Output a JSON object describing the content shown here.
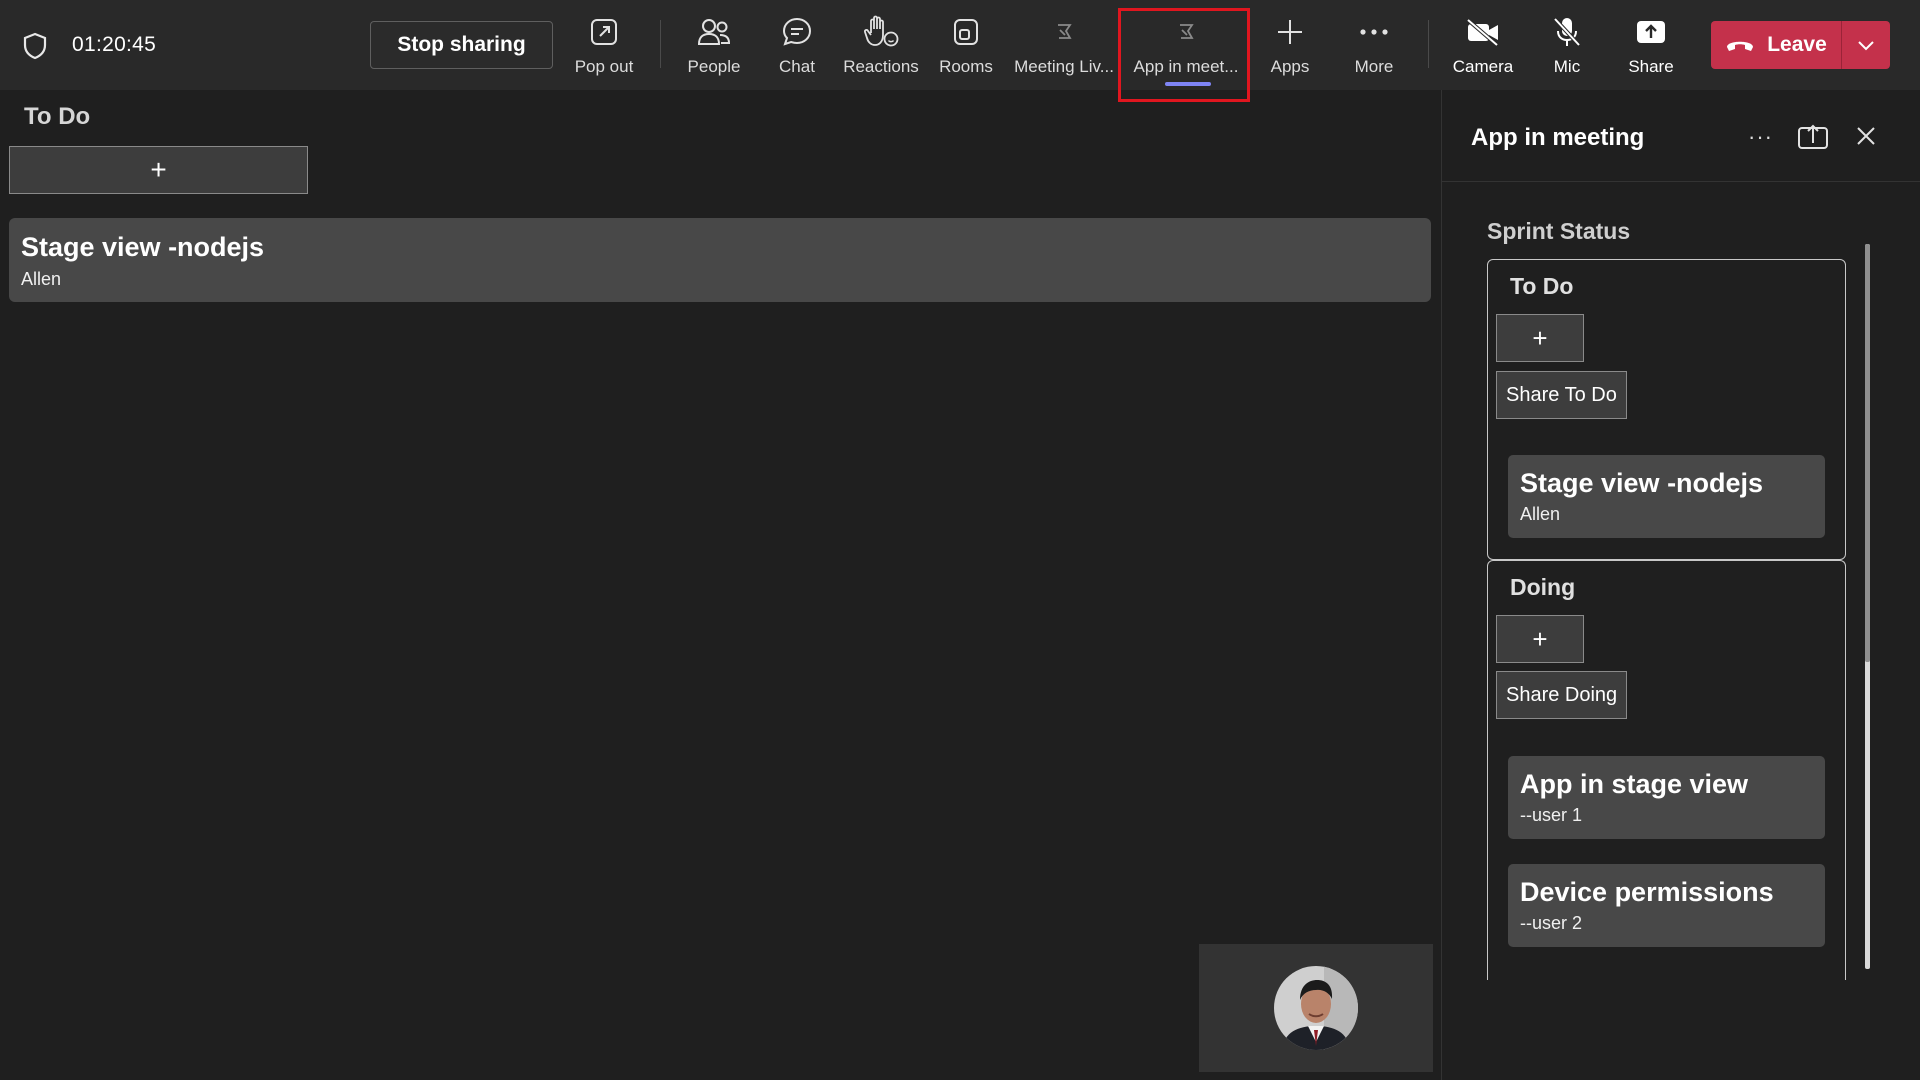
{
  "meeting": {
    "timer": "01:20:45",
    "stop_sharing_label": "Stop sharing"
  },
  "toolbar": {
    "items": [
      {
        "label": "Pop out",
        "icon": "pop-out-icon"
      },
      {
        "label": "People",
        "icon": "people-icon"
      },
      {
        "label": "Chat",
        "icon": "chat-icon"
      },
      {
        "label": "Reactions",
        "icon": "raise-hand-icon"
      },
      {
        "label": "Rooms",
        "icon": "rooms-icon"
      },
      {
        "label": "Meeting Liv...",
        "icon": "app-icon"
      },
      {
        "label": "App in meet...",
        "icon": "app-icon",
        "selected": true
      },
      {
        "label": "Apps",
        "icon": "plus-icon"
      },
      {
        "label": "More",
        "icon": "more-icon"
      },
      {
        "label": "Camera",
        "icon": "camera-off-icon"
      },
      {
        "label": "Mic",
        "icon": "mic-off-icon"
      },
      {
        "label": "Share",
        "icon": "share-icon"
      }
    ],
    "leave_label": "Leave",
    "accent_color": "#c4314b",
    "highlight_color": "#e0161f"
  },
  "stage": {
    "column_title": "To Do",
    "add_label": "+",
    "cards": [
      {
        "title": "Stage view -nodejs",
        "subtitle": "Allen"
      }
    ]
  },
  "panel": {
    "title": "App in meeting",
    "more_label": "···",
    "section_title": "Sprint Status",
    "columns": [
      {
        "title": "To Do",
        "add_label": "+",
        "share_label": "Share To Do",
        "cards": [
          {
            "title": "Stage view -nodejs",
            "subtitle": "Allen"
          }
        ]
      },
      {
        "title": "Doing",
        "add_label": "+",
        "share_label": "Share Doing",
        "cards": [
          {
            "title": "App in stage view",
            "subtitle": "--user 1"
          },
          {
            "title": "Device permissions",
            "subtitle": "--user 2"
          }
        ]
      }
    ]
  }
}
